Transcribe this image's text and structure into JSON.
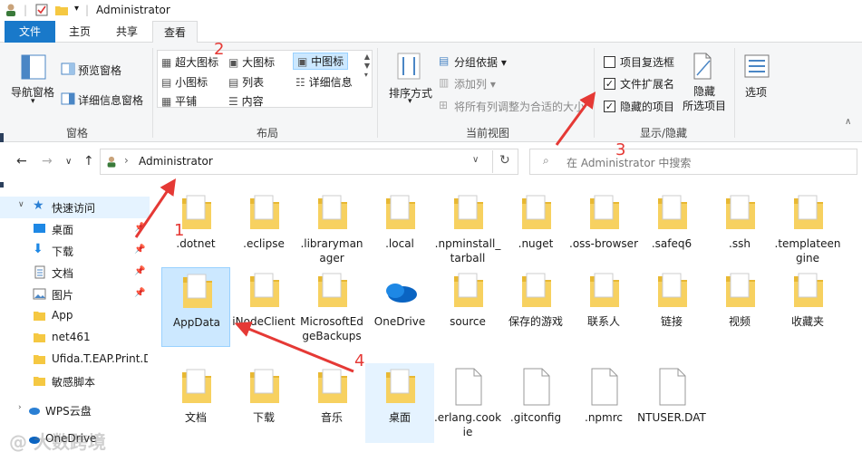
{
  "window": {
    "title": "Administrator"
  },
  "tabs": [
    {
      "label": "文件"
    },
    {
      "label": "主页"
    },
    {
      "label": "共享"
    },
    {
      "label": "查看"
    }
  ],
  "ribbon": {
    "panes": {
      "nav_pane": "导航窗格",
      "preview_pane": "预览窗格",
      "details_pane": "详细信息窗格",
      "group_label": "窗格"
    },
    "layout": {
      "options": {
        "extra_large": "超大图标",
        "large": "大图标",
        "medium": "中图标",
        "small": "小图标",
        "list": "列表",
        "details": "详细信息",
        "tiles": "平铺",
        "content": "内容"
      },
      "selected": "中图标",
      "group_label": "布局"
    },
    "current_view": {
      "sort": "排序方式",
      "group_by": "分组依据",
      "add_columns": "添加列",
      "fit_columns": "将所有列调整为合适的大小",
      "group_label": "当前视图"
    },
    "show_hide": {
      "item_checkboxes": {
        "label": "项目复选框",
        "checked": false
      },
      "file_extensions": {
        "label": "文件扩展名",
        "checked": true
      },
      "hidden_items": {
        "label": "隐藏的项目",
        "checked": true
      },
      "hide_selected": "隐藏\n所选项目",
      "hide_selected_line1": "隐藏",
      "hide_selected_line2": "所选项目",
      "group_label": "显示/隐藏"
    },
    "options": "选项"
  },
  "address": {
    "path": "Administrator",
    "search_placeholder": "在 Administrator 中搜索"
  },
  "sidebar": {
    "items": [
      {
        "label": "快速访问",
        "icon": "star-icon"
      },
      {
        "label": "桌面",
        "icon": "desktop-icon",
        "pinned": true
      },
      {
        "label": "下载",
        "icon": "download-icon",
        "pinned": true
      },
      {
        "label": "文档",
        "icon": "document-icon",
        "pinned": true
      },
      {
        "label": "图片",
        "icon": "picture-icon",
        "pinned": true
      },
      {
        "label": "App",
        "icon": "folder-icon"
      },
      {
        "label": "net461",
        "icon": "folder-icon"
      },
      {
        "label": "Ufida.T.EAP.Print.D",
        "icon": "folder-icon"
      },
      {
        "label": "敏感脚本",
        "icon": "folder-icon"
      },
      {
        "label": "WPS云盘",
        "icon": "cloud-icon"
      },
      {
        "label": "OneDrive",
        "icon": "onedrive-icon"
      }
    ]
  },
  "files": [
    {
      "name": ".dotnet",
      "type": "folder"
    },
    {
      "name": ".eclipse",
      "type": "folder"
    },
    {
      "name": ".librarymanager",
      "type": "folder"
    },
    {
      "name": ".local",
      "type": "folder"
    },
    {
      "name": ".npminstall_tarball",
      "type": "folder"
    },
    {
      "name": ".nuget",
      "type": "folder"
    },
    {
      "name": ".oss-browser",
      "type": "folder"
    },
    {
      "name": ".safeq6",
      "type": "folder"
    },
    {
      "name": ".ssh",
      "type": "folder"
    },
    {
      "name": ".templateengine",
      "type": "folder"
    },
    {
      "name": "AppData",
      "type": "folder"
    },
    {
      "name": "iNodeClient",
      "type": "folder"
    },
    {
      "name": "MicrosoftEdgeBackups",
      "type": "folder"
    },
    {
      "name": "OneDrive",
      "type": "onedrive"
    },
    {
      "name": "source",
      "type": "folder"
    },
    {
      "name": "保存的游戏",
      "type": "folder"
    },
    {
      "name": "联系人",
      "type": "folder"
    },
    {
      "name": "链接",
      "type": "folder"
    },
    {
      "name": "视频",
      "type": "folder"
    },
    {
      "name": "收藏夹",
      "type": "folder"
    },
    {
      "name": "文档",
      "type": "folder"
    },
    {
      "name": "下载",
      "type": "folder"
    },
    {
      "name": "音乐",
      "type": "folder"
    },
    {
      "name": "桌面",
      "type": "folder"
    },
    {
      "name": ".erlang.cookie",
      "type": "file"
    },
    {
      "name": ".gitconfig",
      "type": "file"
    },
    {
      "name": ".npmrc",
      "type": "file"
    },
    {
      "name": "NTUSER.DAT",
      "type": "file"
    }
  ],
  "annotations": [
    "1",
    "2",
    "3",
    "4"
  ],
  "watermark": "@ 大数跨境",
  "colors": {
    "accent": "#1979ca",
    "annotation": "#e53935",
    "selection": "#cce8ff",
    "folder": "#f5c842"
  }
}
